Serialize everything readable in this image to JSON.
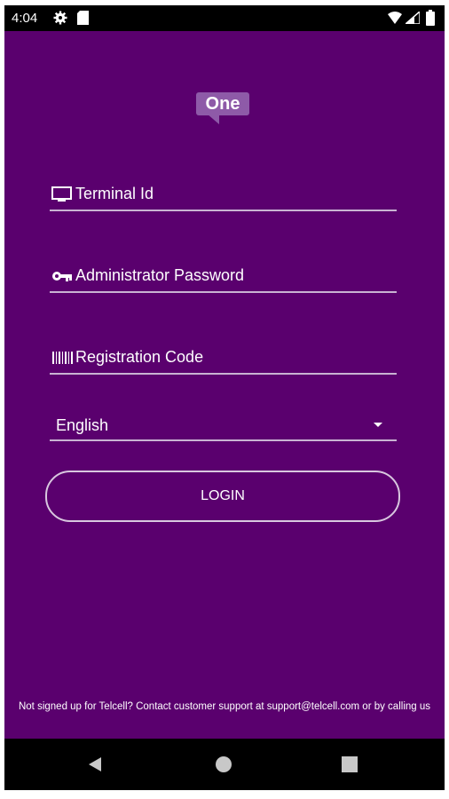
{
  "status_bar": {
    "time": "4:04",
    "icons": [
      "gear-icon",
      "sd-card-icon",
      "wifi-icon",
      "signal-icon",
      "battery-icon"
    ]
  },
  "logo": {
    "text": "One",
    "color": "#8e5aa8"
  },
  "form": {
    "terminal_id": {
      "placeholder": "Terminal Id",
      "value": "",
      "icon": "monitor-icon"
    },
    "admin_password": {
      "placeholder": "Administrator Password",
      "value": "",
      "icon": "key-icon"
    },
    "registration_code": {
      "placeholder": "Registration Code",
      "value": "",
      "icon": "barcode-icon"
    },
    "language": {
      "selected": "English",
      "icon": "dropdown-caret-icon"
    },
    "login_label": "LOGIN"
  },
  "footer": {
    "text": "Not signed up for Telcell? Contact customer support at support@telcell.com or by calling us"
  },
  "colors": {
    "background": "#5a006e",
    "underline": "#c9b3d3",
    "text": "#ffffff"
  },
  "nav_bar": {
    "icons": [
      "back-icon",
      "home-icon",
      "recents-icon"
    ]
  }
}
